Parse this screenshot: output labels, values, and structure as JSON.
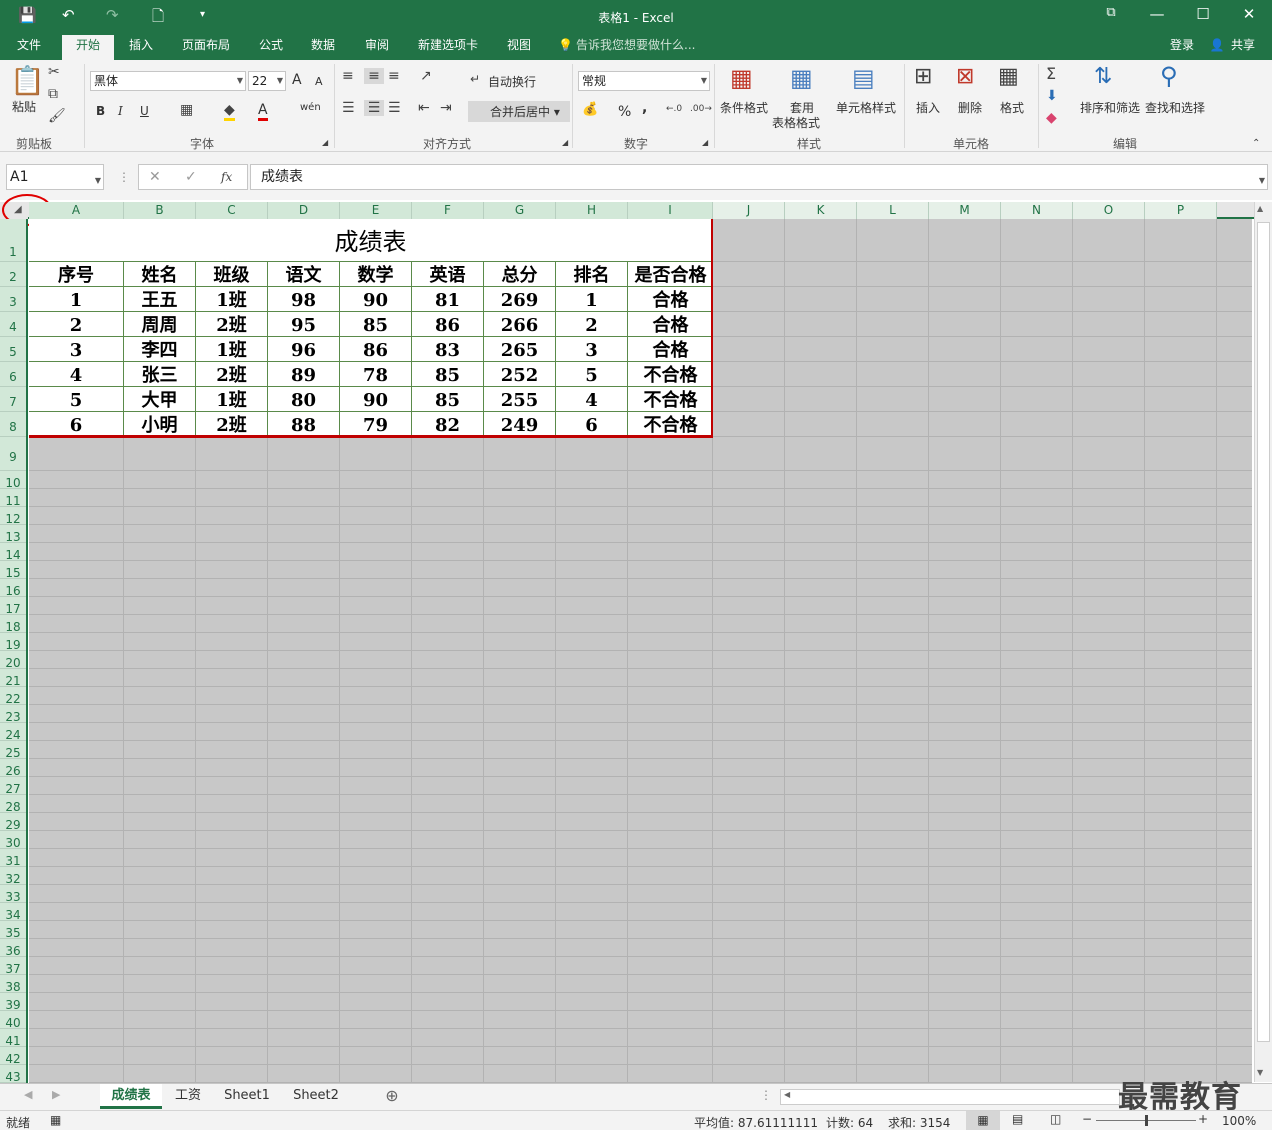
{
  "window": {
    "title": "表格1 - Excel",
    "minimize": "—",
    "restore": "☐",
    "close": "✕"
  },
  "quick_access": {
    "save": "💾",
    "undo": "↶",
    "redo": "↷",
    "new": "🗋",
    "more": "▾"
  },
  "tabs": [
    {
      "label": "文件",
      "active": false
    },
    {
      "label": "开始",
      "active": true
    },
    {
      "label": "插入",
      "active": false
    },
    {
      "label": "页面布局",
      "active": false
    },
    {
      "label": "公式",
      "active": false
    },
    {
      "label": "数据",
      "active": false
    },
    {
      "label": "审阅",
      "active": false
    },
    {
      "label": "新建选项卡",
      "active": false
    },
    {
      "label": "视图",
      "active": false
    }
  ],
  "tell_me": "告诉我您想要做什么...",
  "login": "登录",
  "share": "共享",
  "ribbon": {
    "clipboard": {
      "label": "剪贴板",
      "paste": "粘贴"
    },
    "font": {
      "label": "字体",
      "name": "黑体",
      "size": "22",
      "bold": "B",
      "italic": "I",
      "underline": "U",
      "grow": "A",
      "shrink": "A",
      "font_color": "A",
      "wen": "wén"
    },
    "align": {
      "label": "对齐方式",
      "wrap": "自动换行",
      "merge": "合并后居中"
    },
    "number": {
      "label": "数字",
      "format": "常规",
      "percent": "%",
      "comma": ","
    },
    "styles": {
      "label": "样式",
      "conditional": "条件格式",
      "table_fmt_1": "套用",
      "table_fmt_2": "表格格式",
      "cell_style": "单元格样式"
    },
    "cells": {
      "label": "单元格",
      "insert": "插入",
      "delete": "删除",
      "format": "格式"
    },
    "edit": {
      "label": "编辑",
      "sort": "排序和筛选",
      "find": "查找和选择"
    }
  },
  "formula_bar": {
    "name_box": "A1",
    "fx": "fx",
    "content": "成绩表"
  },
  "columns": [
    "A",
    "B",
    "C",
    "D",
    "E",
    "F",
    "G",
    "H",
    "I",
    "J",
    "K",
    "L",
    "M",
    "N",
    "O",
    "P"
  ],
  "rows": [
    "1",
    "2",
    "3",
    "4",
    "5",
    "6",
    "7",
    "8",
    "9",
    "10",
    "11",
    "12",
    "13",
    "14",
    "15",
    "16",
    "17",
    "18",
    "19",
    "20",
    "21",
    "22",
    "23",
    "24",
    "25",
    "26",
    "27",
    "28",
    "29",
    "30",
    "31",
    "32",
    "33",
    "34",
    "35",
    "36",
    "37",
    "38",
    "39",
    "40",
    "41",
    "42",
    "43"
  ],
  "sheet": {
    "title": "成绩表",
    "headers": [
      "序号",
      "姓名",
      "班级",
      "语文",
      "数学",
      "英语",
      "总分",
      "排名",
      "是否合格"
    ],
    "rows": [
      [
        "1",
        "王五",
        "1班",
        "98",
        "90",
        "81",
        "269",
        "1",
        "合格"
      ],
      [
        "2",
        "周周",
        "2班",
        "95",
        "85",
        "86",
        "266",
        "2",
        "合格"
      ],
      [
        "3",
        "李四",
        "1班",
        "96",
        "86",
        "83",
        "265",
        "3",
        "合格"
      ],
      [
        "4",
        "张三",
        "2班",
        "89",
        "78",
        "85",
        "252",
        "5",
        "不合格"
      ],
      [
        "5",
        "大甲",
        "1班",
        "80",
        "90",
        "85",
        "255",
        "4",
        "不合格"
      ],
      [
        "6",
        "小明",
        "2班",
        "88",
        "79",
        "82",
        "249",
        "6",
        "不合格"
      ]
    ]
  },
  "sheet_tabs": [
    {
      "label": "成绩表",
      "active": true
    },
    {
      "label": "工资",
      "active": false
    },
    {
      "label": "Sheet1",
      "active": false
    },
    {
      "label": "Sheet2",
      "active": false
    }
  ],
  "add_sheet": "⊕",
  "watermark": "最需教育",
  "status": {
    "ready": "就绪",
    "average": "平均值: 87.61111111",
    "count": "计数: 64",
    "sum": "求和: 3154",
    "zoom": "100%",
    "zoom_level": 0.5
  },
  "colors": {
    "accent": "#217346",
    "selection_border": "#c00000",
    "selected_fill": "#c8c8c8"
  }
}
